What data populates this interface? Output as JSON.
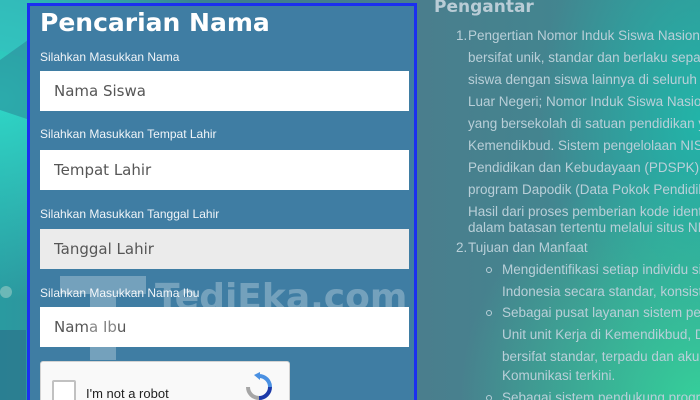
{
  "form": {
    "title": "Pencarian Nama",
    "fields": [
      {
        "label": "Silahkan Masukkan Nama",
        "placeholder": "Nama Siswa"
      },
      {
        "label": "Silahkan Masukkan Tempat Lahir",
        "placeholder": "Tempat Lahir"
      },
      {
        "label": "Silahkan Masukkan Tanggal Lahir",
        "placeholder": "Tanggal Lahir"
      },
      {
        "label": "Silahkan Masukkan Nama Ibu",
        "placeholder": "Nama Ibu"
      }
    ],
    "captcha": {
      "label": "I'm not a robot"
    }
  },
  "watermark": {
    "text": "TediEka.com",
    "letter": "T"
  },
  "intro": {
    "title": "Pengantar",
    "item1_number": "1.",
    "item1_lines": [
      "Pengertian Nomor Induk Siswa Nasional a",
      "bersifat unik, standar dan berlaku sepanj",
      "siswa dengan siswa lainnya di seluruh sek",
      "Luar Negeri; Nomor Induk Siswa Nasiona",
      "yang bersekolah di satuan pendidikan ya",
      "Kemendikbud. Sistem pengelolaan NISN",
      "Pendidikan dan Kebudayaan (PDSPK) Ke",
      "program Dapodik (Data Pokok Pendidika",
      "Hasil dari proses pemberian kode identifi",
      "dalam batasan tertentu melalui situs NISI"
    ],
    "item2_number": "2.",
    "item2_title": "Tujuan dan Manfaat",
    "bullets": [
      {
        "lines": [
          "Mengidentifikasi setiap individu sisv",
          "Indonesia secara standar, konsister"
        ]
      },
      {
        "lines": [
          "Sebagai pusat layanan sistem peng",
          "Unit unit Kerja di Kemendikbud, Dir",
          "bersifat standar, terpadu dan akunt",
          "Komunikasi terkini."
        ]
      },
      {
        "lines": [
          "Sebagai sistem pendukung program"
        ]
      }
    ]
  },
  "colors": {
    "panel_border": "#1b2ff0",
    "panel_bg": "#3f7da3",
    "text_muted": "#b9cfd8"
  }
}
